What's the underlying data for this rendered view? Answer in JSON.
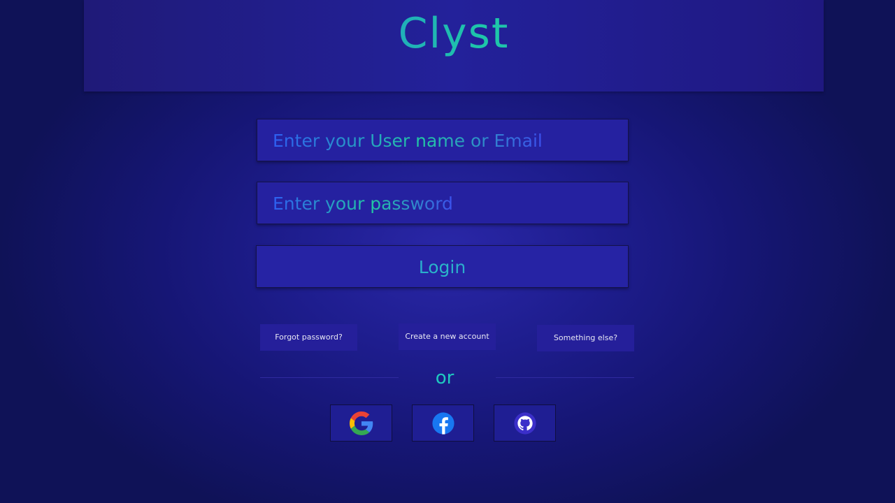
{
  "header": {
    "brand": "Clyst"
  },
  "form": {
    "username_placeholder": "Enter your User name or Email",
    "password_placeholder": "Enter your password",
    "login_label": "Login"
  },
  "links": {
    "forgot": "Forgot password?",
    "create": "Create a new account",
    "other": "Something else?"
  },
  "divider": {
    "text": "or"
  },
  "social": [
    {
      "name": "google",
      "icon": "google-icon"
    },
    {
      "name": "facebook",
      "icon": "facebook-icon"
    },
    {
      "name": "github",
      "icon": "github-icon"
    }
  ],
  "colors": {
    "background": "#1e1d8e",
    "accent_teal": "#1fc9a7",
    "accent_blue": "#2e5df2"
  }
}
